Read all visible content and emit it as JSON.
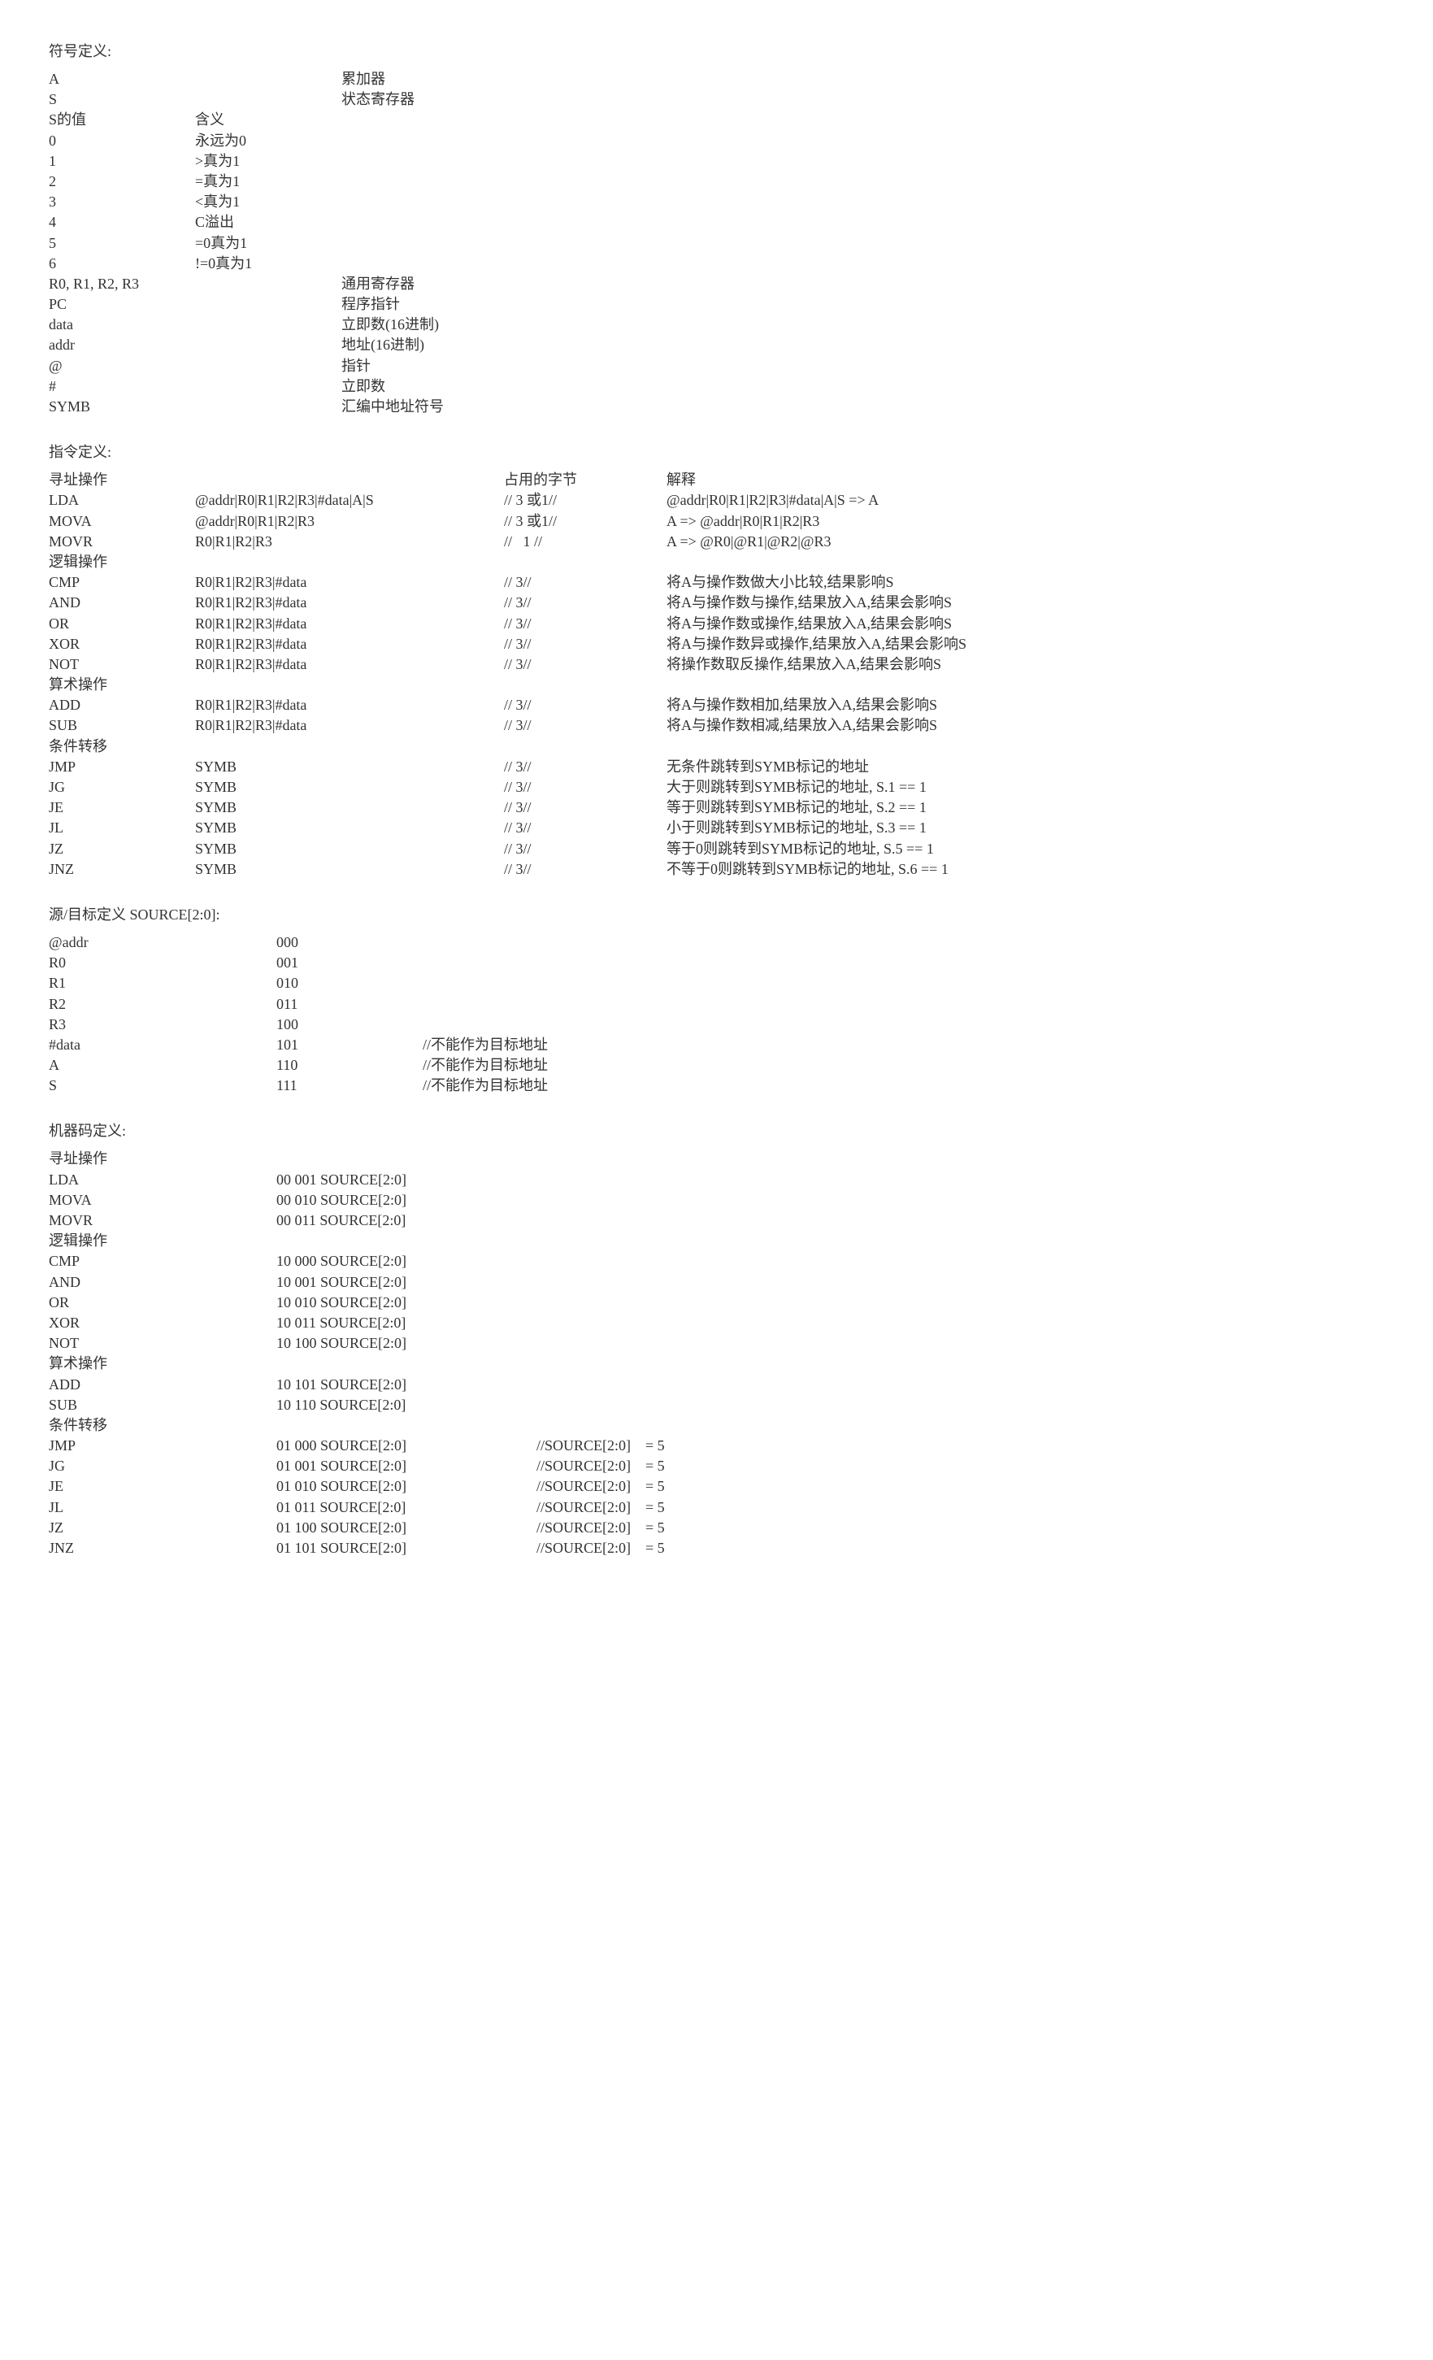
{
  "symbol_def": {
    "title": "符号定义:",
    "items": [
      [
        "A",
        "",
        "累加器"
      ],
      [
        "S",
        "",
        "状态寄存器"
      ],
      [
        "S的值",
        "含义",
        ""
      ],
      [
        "0",
        "永远为0",
        ""
      ],
      [
        "1",
        ">真为1",
        ""
      ],
      [
        "2",
        "=真为1",
        ""
      ],
      [
        "3",
        "<真为1",
        ""
      ],
      [
        "4",
        "C溢出",
        ""
      ],
      [
        "5",
        "=0真为1",
        ""
      ],
      [
        "6",
        "!=0真为1",
        ""
      ],
      [
        "R0, R1, R2, R3",
        "",
        "通用寄存器"
      ],
      [
        "PC",
        "",
        "程序指针"
      ],
      [
        "data",
        "",
        "立即数(16进制)"
      ],
      [
        "addr",
        "",
        "地址(16进制)"
      ],
      [
        "@",
        "",
        "指针"
      ],
      [
        "#",
        "",
        "立即数"
      ],
      [
        "SYMB",
        "",
        "汇编中地址符号"
      ]
    ]
  },
  "instr_def": {
    "title": "指令定义:",
    "header": [
      "",
      "",
      "占用的字节",
      "解释"
    ],
    "groups": [
      {
        "name": "寻址操作",
        "rows": [
          [
            "LDA",
            "@addr|R0|R1|R2|R3|#data|A|S",
            "// 3 或1//",
            "@addr|R0|R1|R2|R3|#data|A|S => A"
          ],
          [
            "MOVA",
            "@addr|R0|R1|R2|R3",
            "// 3 或1//",
            "A => @addr|R0|R1|R2|R3"
          ],
          [
            "MOVR",
            "R0|R1|R2|R3",
            "//   1 //",
            "A => @R0|@R1|@R2|@R3"
          ]
        ]
      },
      {
        "name": "逻辑操作",
        "rows": [
          [
            "CMP",
            "R0|R1|R2|R3|#data",
            "// 3//",
            "将A与操作数做大小比较,结果影响S"
          ],
          [
            "AND",
            "R0|R1|R2|R3|#data",
            "// 3//",
            "将A与操作数与操作,结果放入A,结果会影响S"
          ],
          [
            "OR",
            "R0|R1|R2|R3|#data",
            "// 3//",
            "将A与操作数或操作,结果放入A,结果会影响S"
          ],
          [
            "XOR",
            "R0|R1|R2|R3|#data",
            "// 3//",
            "将A与操作数异或操作,结果放入A,结果会影响S"
          ],
          [
            "NOT",
            "R0|R1|R2|R3|#data",
            "// 3//",
            "将操作数取反操作,结果放入A,结果会影响S"
          ]
        ]
      },
      {
        "name": "算术操作",
        "rows": [
          [
            "ADD",
            "R0|R1|R2|R3|#data",
            "// 3//",
            "将A与操作数相加,结果放入A,结果会影响S"
          ],
          [
            "SUB",
            "R0|R1|R2|R3|#data",
            "// 3//",
            "将A与操作数相减,结果放入A,结果会影响S"
          ]
        ]
      },
      {
        "name": "条件转移",
        "rows": [
          [
            "JMP",
            "SYMB",
            "// 3//",
            "无条件跳转到SYMB标记的地址"
          ],
          [
            "JG",
            "SYMB",
            "// 3//",
            "大于则跳转到SYMB标记的地址, S.1 == 1"
          ],
          [
            "JE",
            "SYMB",
            "// 3//",
            "等于则跳转到SYMB标记的地址, S.2 == 1"
          ],
          [
            "JL",
            "SYMB",
            "// 3//",
            "小于则跳转到SYMB标记的地址, S.3 == 1"
          ],
          [
            "JZ",
            "SYMB",
            "// 3//",
            "等于0则跳转到SYMB标记的地址, S.5 == 1"
          ],
          [
            "JNZ",
            "SYMB",
            "// 3//",
            "不等于0则跳转到SYMB标记的地址, S.6 == 1"
          ]
        ]
      }
    ]
  },
  "source_def": {
    "title": "源/目标定义 SOURCE[2:0]:",
    "rows": [
      [
        "@addr",
        "000",
        ""
      ],
      [
        "R0",
        "001",
        ""
      ],
      [
        "R1",
        "010",
        ""
      ],
      [
        "R2",
        "011",
        ""
      ],
      [
        "R3",
        "100",
        ""
      ],
      [
        "#data",
        "101",
        "//不能作为目标地址"
      ],
      [
        "A",
        "110",
        "//不能作为目标地址"
      ],
      [
        "S",
        "111",
        "//不能作为目标地址"
      ]
    ]
  },
  "machine_def": {
    "title": "机器码定义:",
    "groups": [
      {
        "name": "寻址操作",
        "rows": [
          [
            "LDA",
            "00 001 SOURCE[2:0]",
            ""
          ],
          [
            "MOVA",
            "00 010 SOURCE[2:0]",
            ""
          ],
          [
            "MOVR",
            "00 011 SOURCE[2:0]",
            ""
          ]
        ]
      },
      {
        "name": "逻辑操作",
        "rows": [
          [
            "CMP",
            "10 000 SOURCE[2:0]",
            ""
          ],
          [
            "AND",
            "10 001 SOURCE[2:0]",
            ""
          ],
          [
            "OR",
            "10 010 SOURCE[2:0]",
            ""
          ],
          [
            "XOR",
            "10 011 SOURCE[2:0]",
            ""
          ],
          [
            "NOT",
            "10 100 SOURCE[2:0]",
            ""
          ]
        ]
      },
      {
        "name": "算术操作",
        "rows": [
          [
            "ADD",
            "10 101 SOURCE[2:0]",
            ""
          ],
          [
            "SUB",
            "10 110 SOURCE[2:0]",
            ""
          ]
        ]
      },
      {
        "name": "条件转移",
        "rows": [
          [
            "JMP",
            "01 000 SOURCE[2:0]",
            "//SOURCE[2:0]    = 5"
          ],
          [
            "JG",
            "01 001 SOURCE[2:0]",
            "//SOURCE[2:0]    = 5"
          ],
          [
            "JE",
            "01 010 SOURCE[2:0]",
            "//SOURCE[2:0]    = 5"
          ],
          [
            "JL",
            "01 011 SOURCE[2:0]",
            "//SOURCE[2:0]    = 5"
          ],
          [
            "JZ",
            "01 100 SOURCE[2:0]",
            "//SOURCE[2:0]    = 5"
          ],
          [
            "JNZ",
            "01 101 SOURCE[2:0]",
            "//SOURCE[2:0]    = 5"
          ]
        ]
      }
    ]
  }
}
